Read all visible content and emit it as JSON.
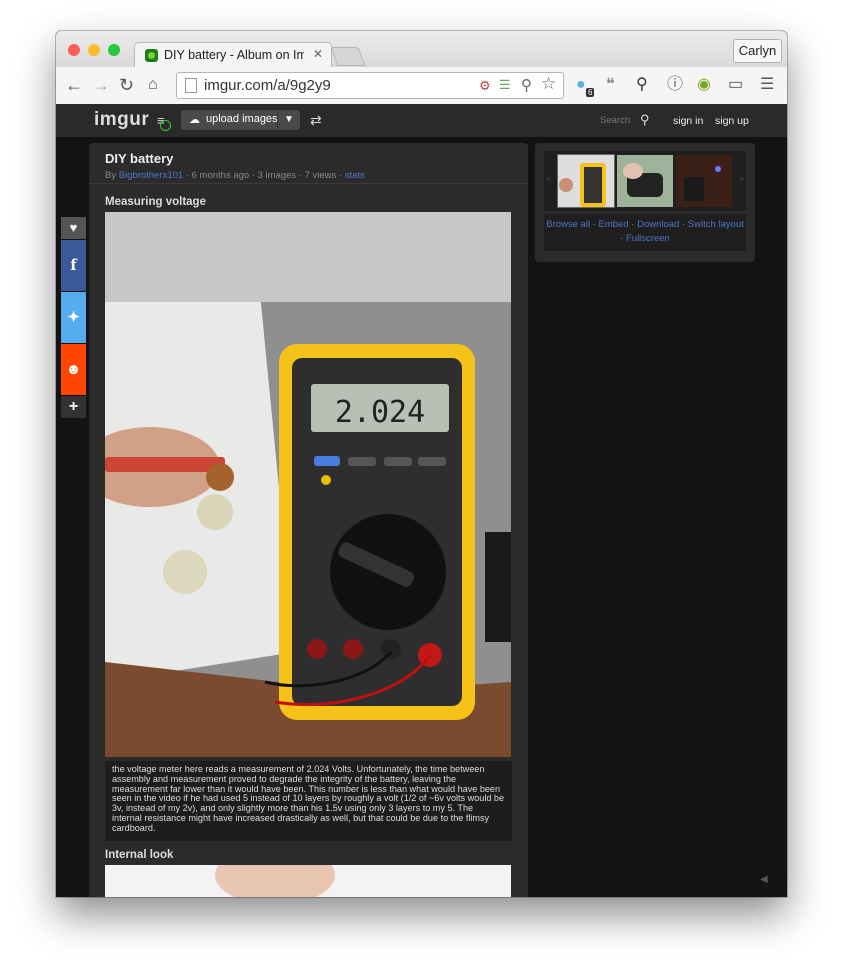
{
  "browser": {
    "tab_title": "DIY battery - Album on Imgur",
    "url": "imgur.com/a/9g2y9",
    "profile_name": "Carlyn",
    "extension_badge": "6"
  },
  "nav": {
    "logo": "imgur",
    "upload_label": "upload images",
    "search_label": "Search",
    "sign_in": "sign in",
    "sign_up": "sign up"
  },
  "album": {
    "title": "DIY battery",
    "by_label": "By",
    "author": "Bigbrotherx101",
    "meta": " · 6 months ago · 3 images · 7 views · ",
    "stats_link": "stats"
  },
  "images": [
    {
      "title": "Measuring voltage",
      "meter_reading": "2.024",
      "caption": "the voltage meter here reads a measurement of 2.024 Volts. Unfortunately, the time between assembly and measurement proved to degrade the integrity of the battery, leaving the measurement far lower than it would have been. This number is less than what would have been seen in the video if he had used 5 instead of 10 layers by roughly a volt (1/2 of ~6v volts would be 3v, instead of my 2v), and only slightly more than his 1.5v using only 3 layers to my 5. The internal resistance might have increased drastically as well, but that could be due to the flimsy cardboard."
    },
    {
      "title": "Internal look"
    }
  ],
  "right_panel": {
    "browse_all": "Browse all",
    "embed": "Embed",
    "download": "Download",
    "switch_layout": "Switch layout",
    "fullscreen": "Fullscreen",
    "separator": " · "
  },
  "colors": {
    "link": "#4e76c9",
    "facebook": "#3b5998",
    "twitter": "#55acee",
    "reddit": "#ff4500",
    "page_bg": "#131313",
    "panel_bg": "#2b2b2b"
  },
  "icons": [
    "back-icon",
    "forward-icon",
    "reload-icon",
    "home-icon",
    "page-icon",
    "extension-icon",
    "rss-icon",
    "magnifier-icon",
    "star-icon",
    "ghostery-icon",
    "chat-icon",
    "search-icon",
    "info-icon",
    "color-icon",
    "cast-icon",
    "menu-icon",
    "heart-icon",
    "facebook-icon",
    "twitter-icon",
    "reddit-icon",
    "plus-icon",
    "shuffle-icon",
    "cloud-icon",
    "chevron-down-icon"
  ]
}
